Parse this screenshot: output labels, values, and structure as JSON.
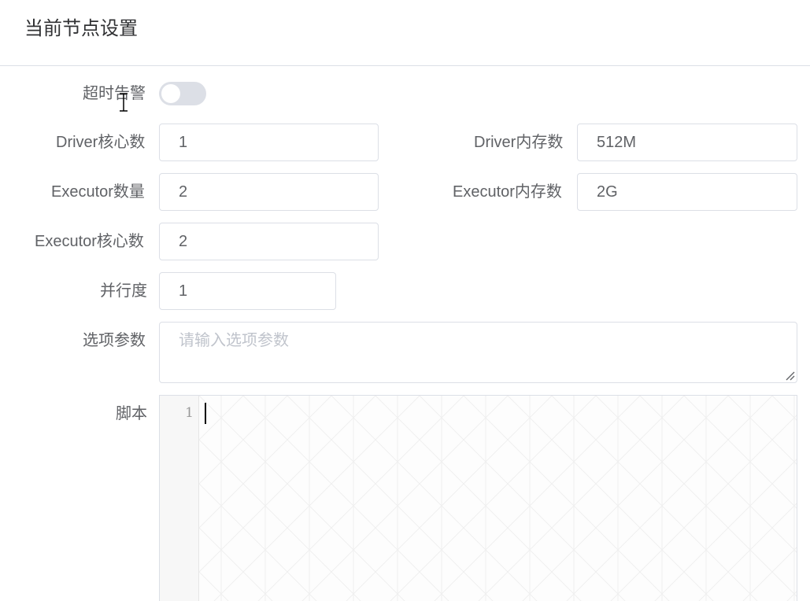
{
  "header": {
    "title": "当前节点设置"
  },
  "form": {
    "timeout_alarm": {
      "label": "超时告警",
      "enabled": false
    },
    "driver_cores": {
      "label": "Driver核心数",
      "value": "1"
    },
    "driver_memory": {
      "label": "Driver内存数",
      "value": "512M"
    },
    "executor_count": {
      "label": "Executor数量",
      "value": "2"
    },
    "executor_memory": {
      "label": "Executor内存数",
      "value": "2G"
    },
    "executor_cores": {
      "label": "Executor核心数",
      "value": "2"
    },
    "parallelism": {
      "label": "并行度",
      "value": "1"
    },
    "options": {
      "label": "选项参数",
      "placeholder": "请输入选项参数",
      "value": ""
    },
    "script": {
      "label": "脚本",
      "line_numbers": [
        "1"
      ],
      "content": ""
    }
  },
  "icons": {
    "resize": "resize-handle-icon",
    "text_cursor": "text-cursor-icon"
  },
  "colors": {
    "switch_off": "#dcdfe6",
    "border": "#dcdfe6",
    "label": "#606266",
    "placeholder": "#c0c4cc",
    "title": "#303133"
  }
}
